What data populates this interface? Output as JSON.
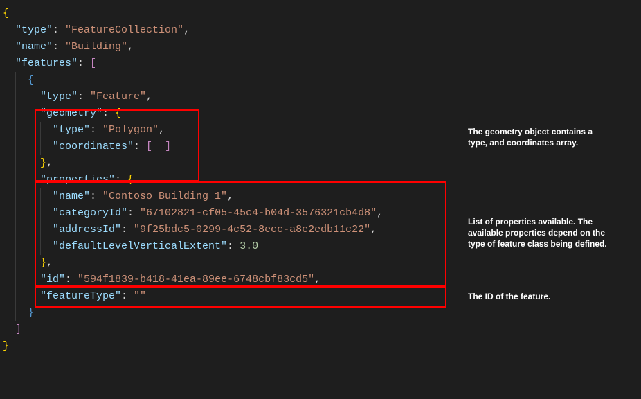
{
  "code": {
    "type_key": "\"type\"",
    "type_val": "\"FeatureCollection\"",
    "name_key": "\"name\"",
    "name_val": "\"Building\"",
    "features_key": "\"features\"",
    "feat_type_key": "\"type\"",
    "feat_type_val": "\"Feature\"",
    "geometry_key": "\"geometry\"",
    "geom_type_key": "\"type\"",
    "geom_type_val": "\"Polygon\"",
    "coords_key": "\"coordinates\"",
    "properties_key": "\"properties\"",
    "prop_name_key": "\"name\"",
    "prop_name_val": "\"Contoso Building 1\"",
    "prop_cat_key": "\"categoryId\"",
    "prop_cat_val": "\"67102821-cf05-45c4-b04d-3576321cb4d8\"",
    "prop_addr_key": "\"addressId\"",
    "prop_addr_val": "\"9f25bdc5-0299-4c52-8ecc-a8e2edb11c22\"",
    "prop_dlve_key": "\"defaultLevelVerticalExtent\"",
    "prop_dlve_val": "3.0",
    "id_key": "\"id\"",
    "id_val": "\"594f1839-b418-41ea-89ee-6748cbf83cd5\"",
    "ft_key": "\"featureType\"",
    "ft_val": "\"\""
  },
  "annotations": {
    "geometry": "The geometry object contains a type, and coordinates array.",
    "properties": "List of properties available. The available properties depend on the type of feature class being defined.",
    "id": "The ID of the feature."
  }
}
